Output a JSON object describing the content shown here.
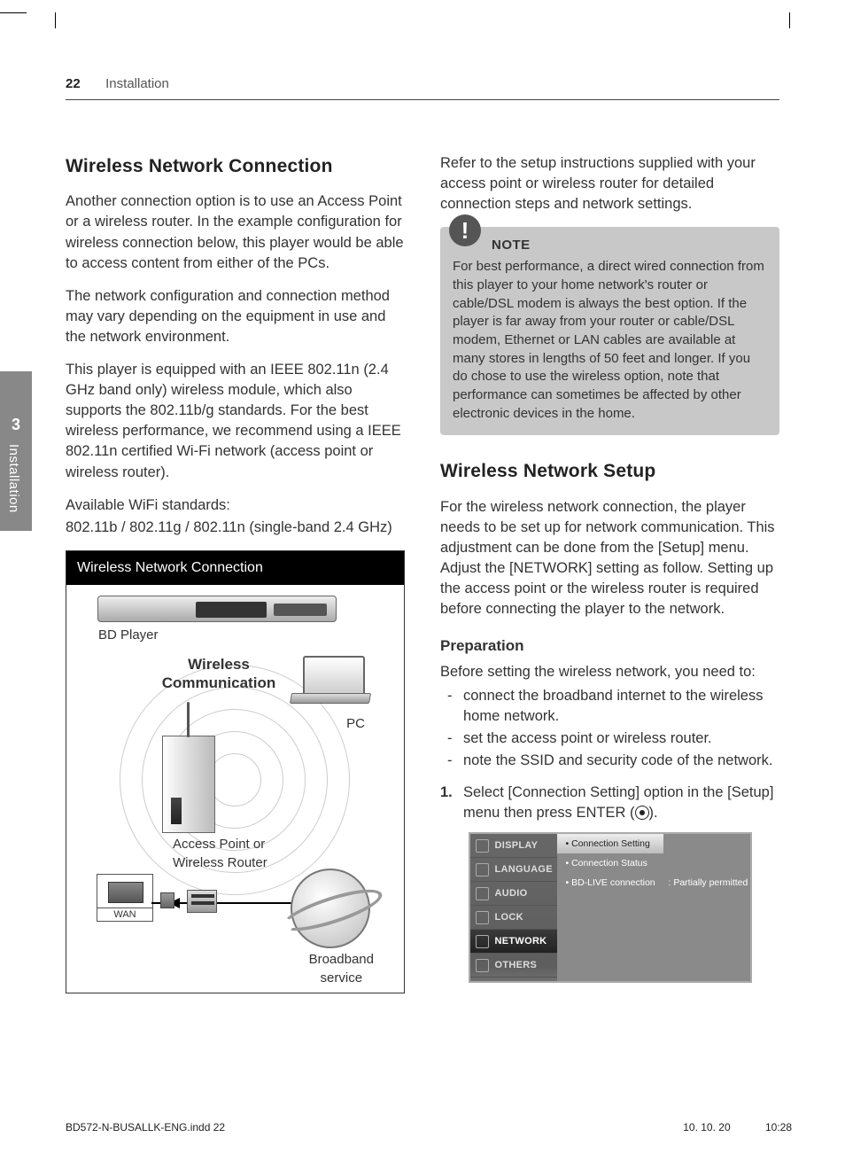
{
  "header": {
    "page_number": "22",
    "section": "Installation"
  },
  "side_tab": {
    "num": "3",
    "label": "Installation"
  },
  "left": {
    "h2": "Wireless Network Connection",
    "p1": "Another connection option is to use an Access Point or a wireless router. In the example configuration for wireless connection below, this player would be able to access content from either of the PCs.",
    "p2": "The network configuration and connection method may vary depending on the equipment in use and the network environment.",
    "p3": "This player is equipped with an IEEE 802.11n (2.4 GHz band only) wireless module, which also supports the 802.11b/g standards. For the best wireless performance, we recommend using a IEEE 802.11n certified Wi-Fi network (access point or wireless router).",
    "std1": "Available WiFi standards:",
    "std2": "802.11b / 802.11g / 802.11n (single-band 2.4 GHz)",
    "diagram": {
      "title": "Wireless Network Connection",
      "bd": "BD Player",
      "wl1": "Wireless",
      "wl2": "Communication",
      "pc": "PC",
      "ap1": "Access Point or",
      "ap2": "Wireless Router",
      "wan": "WAN",
      "bb1": "Broadband",
      "bb2": "service"
    }
  },
  "right": {
    "p1": "Refer to the setup instructions supplied with your access point or wireless router for detailed connection steps and network settings.",
    "note_label": "NOTE",
    "note_text": "For best performance, a direct wired connection from this player to your home network's router or cable/DSL modem is always the best option. If the player is far away from your router or cable/DSL modem, Ethernet or LAN cables are available at many stores in lengths of 50 feet and longer. If you do chose to use the wireless option, note that performance can sometimes be affected by other electronic devices in the home.",
    "h2": "Wireless Network Setup",
    "p2": "For the wireless network connection, the player needs to be set up for network communication. This adjustment can be done from the [Setup] menu. Adjust the [NETWORK] setting as follow. Setting up the access point or the wireless router is required before connecting the player to the network.",
    "h3": "Preparation",
    "prep_intro": "Before setting the wireless network, you need to:",
    "prep": [
      "connect the broadband internet to the wireless home network.",
      "set the access point or wireless router.",
      "note the SSID and security code of the network."
    ],
    "step1_a": "Select [Connection Setting] option in the [Setup] menu then press ENTER (",
    "step1_b": ").",
    "osd": {
      "menu": [
        "DISPLAY",
        "LANGUAGE",
        "AUDIO",
        "LOCK",
        "NETWORK",
        "OTHERS"
      ],
      "options": [
        "Connection Setting",
        "Connection Status",
        "BD-LIVE connection"
      ],
      "value": ": Partially permitted"
    }
  },
  "footer": {
    "file": "BD572-N-BUSALLK-ENG.indd   22",
    "date": "10. 10. 20",
    "time": "10:28"
  }
}
